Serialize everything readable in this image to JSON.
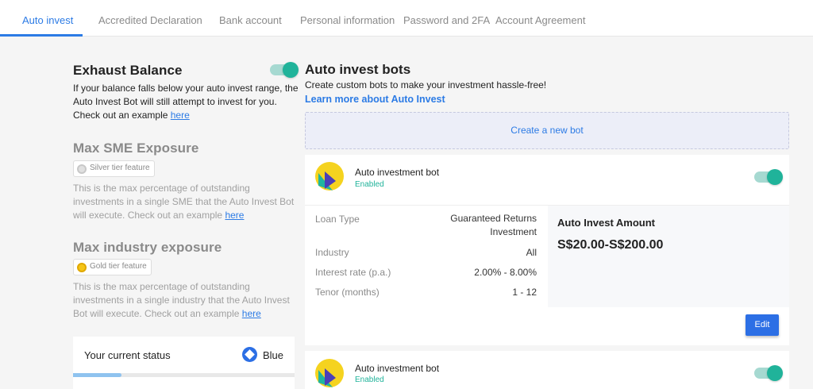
{
  "tabs": [
    {
      "label": "Auto invest",
      "active": true
    },
    {
      "label": "Accredited Declaration"
    },
    {
      "label": "Bank account"
    },
    {
      "label": "Personal information"
    },
    {
      "label": "Password and 2FA"
    },
    {
      "label": "Account Agreement"
    }
  ],
  "exhaust": {
    "title": "Exhaust Balance",
    "text": "If your balance falls below your auto invest range, the Auto Invest Bot will still attempt to invest for you. Check out an example ",
    "link": "here",
    "toggle_on": true
  },
  "sme": {
    "title": "Max SME Exposure",
    "badge": "Silver tier feature",
    "text": "This is the max percentage of outstanding investments in a single SME that the Auto Invest Bot will execute. Check out an example ",
    "link": "here"
  },
  "industry": {
    "title": "Max industry exposure",
    "badge": "Gold tier feature",
    "text": "This is the max percentage of outstanding investments in a single industry that the Auto Invest Bot will execute. Check out an example ",
    "link": "here"
  },
  "status": {
    "label": "Your current status",
    "tier": "Blue",
    "progress_fraction": 0.22
  },
  "bots": {
    "title": "Auto invest bots",
    "subtitle": "Create custom bots to make your investment hassle-free!",
    "learn_more": "Learn more about Auto Invest",
    "create_label": "Create a new bot",
    "items": [
      {
        "name": "Auto investment bot",
        "status": "Enabled",
        "enabled": true,
        "loan_type_label": "Loan Type",
        "loan_type_value_1": "Guaranteed Returns",
        "loan_type_value_2": "Investment",
        "industry_label": "Industry",
        "industry_value": "All",
        "interest_label": "Interest rate (p.a.)",
        "interest_value": "2.00% - 8.00%",
        "tenor_label": "Tenor (months)",
        "tenor_value": "1 - 12",
        "amount_label": "Auto Invest Amount",
        "amount_value": "S$20.00-S$200.00",
        "edit_label": "Edit"
      },
      {
        "name": "Auto investment bot",
        "status": "Enabled",
        "enabled": true
      }
    ]
  },
  "colors": {
    "accent": "#2c7be5",
    "toggle_knob": "#20b39a",
    "enabled_text": "#20b39a"
  }
}
